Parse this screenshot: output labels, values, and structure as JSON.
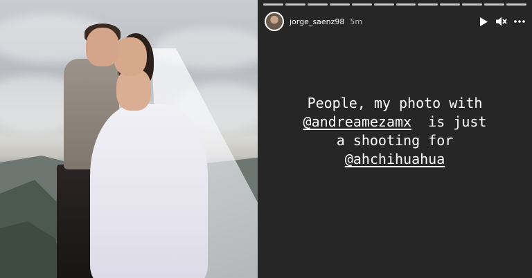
{
  "story": {
    "username": "jorge_saenz98",
    "time_ago": "5m",
    "segments": 12,
    "text": {
      "line1": "People, my photo with",
      "mention1": "@andreamezamx",
      "after_mention1": "  is just",
      "line3": "a shooting for",
      "mention2": "@ahchihuahua"
    },
    "controls": [
      "play-icon",
      "mute-icon",
      "more-icon"
    ]
  },
  "photo": {
    "description_icon": "wedding-photo"
  },
  "colors": {
    "story_background": "#262626",
    "text": "#ffffff",
    "muted": "#b8b8b8"
  }
}
